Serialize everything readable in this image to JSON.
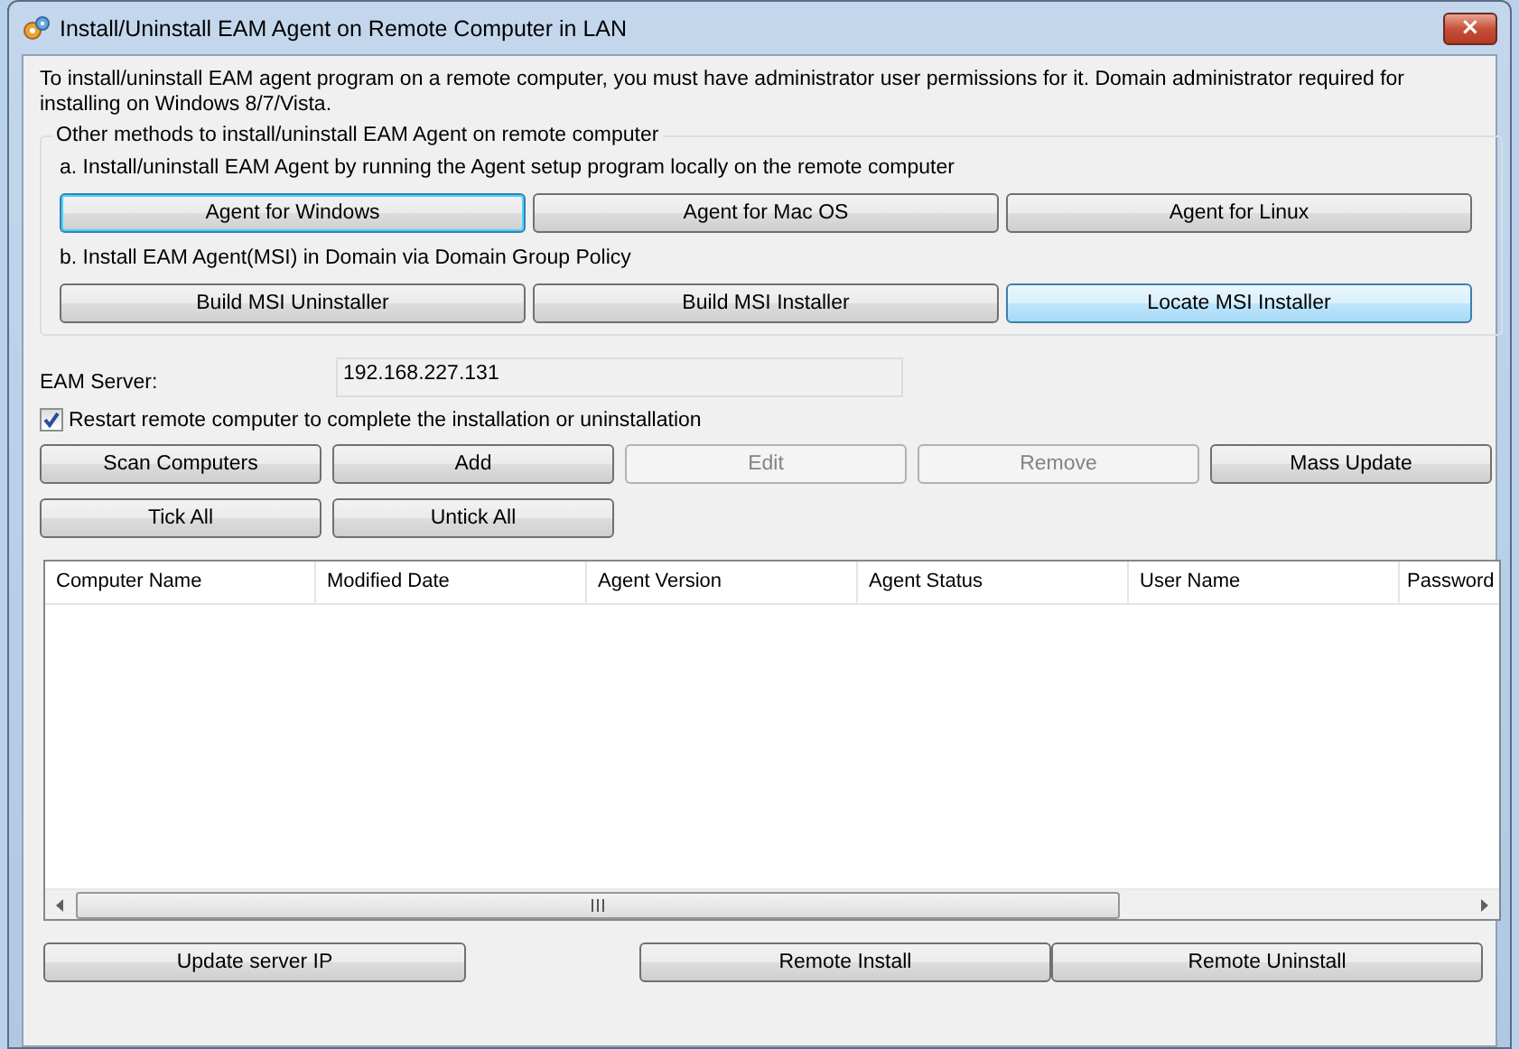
{
  "window": {
    "title": "Install/Uninstall EAM Agent on Remote Computer in LAN",
    "close": "×"
  },
  "intro": "To install/uninstall EAM agent program on a remote computer, you must have administrator user permissions for it. Domain administrator required for installing on Windows 8/7/Vista.",
  "methods": {
    "legend": "Other methods to install/uninstall EAM Agent on remote computer",
    "sections": [
      {
        "caption": "a. Install/uninstall EAM Agent by running the Agent setup program locally on the remote computer",
        "buttons": [
          {
            "label": "Agent for Windows",
            "focused": true,
            "hovered": false
          },
          {
            "label": "Agent for Mac OS",
            "focused": false,
            "hovered": false
          },
          {
            "label": "Agent for Linux",
            "focused": false,
            "hovered": false
          }
        ]
      },
      {
        "caption": "b. Install EAM Agent(MSI) in Domain via Domain Group Policy",
        "buttons": [
          {
            "label": "Build MSI Uninstaller",
            "focused": false,
            "hovered": false
          },
          {
            "label": "Build MSI Installer",
            "focused": false,
            "hovered": false
          },
          {
            "label": "Locate MSI Installer",
            "focused": false,
            "hovered": true
          }
        ]
      }
    ]
  },
  "server": {
    "label": "EAM Server:",
    "value": "192.168.227.131"
  },
  "restart": {
    "label": "Restart remote computer to complete the installation or uninstallation",
    "checked": true
  },
  "action_rows": [
    [
      {
        "label": "Scan Computers",
        "disabled": false
      },
      {
        "label": "Add",
        "disabled": false
      },
      {
        "label": "Edit",
        "disabled": true
      },
      {
        "label": "Remove",
        "disabled": true
      },
      {
        "label": "Mass Update",
        "disabled": false
      }
    ],
    [
      {
        "label": "Tick All",
        "disabled": false
      },
      {
        "label": "Untick All",
        "disabled": false
      }
    ]
  ],
  "table": {
    "columns": [
      "Computer Name",
      "Modified Date",
      "Agent Version",
      "Agent Status",
      "User Name",
      "Password"
    ]
  },
  "bottom_buttons": [
    {
      "label": "Update server IP"
    },
    {
      "label": "Remote Install"
    },
    {
      "label": "Remote Uninstall"
    }
  ]
}
